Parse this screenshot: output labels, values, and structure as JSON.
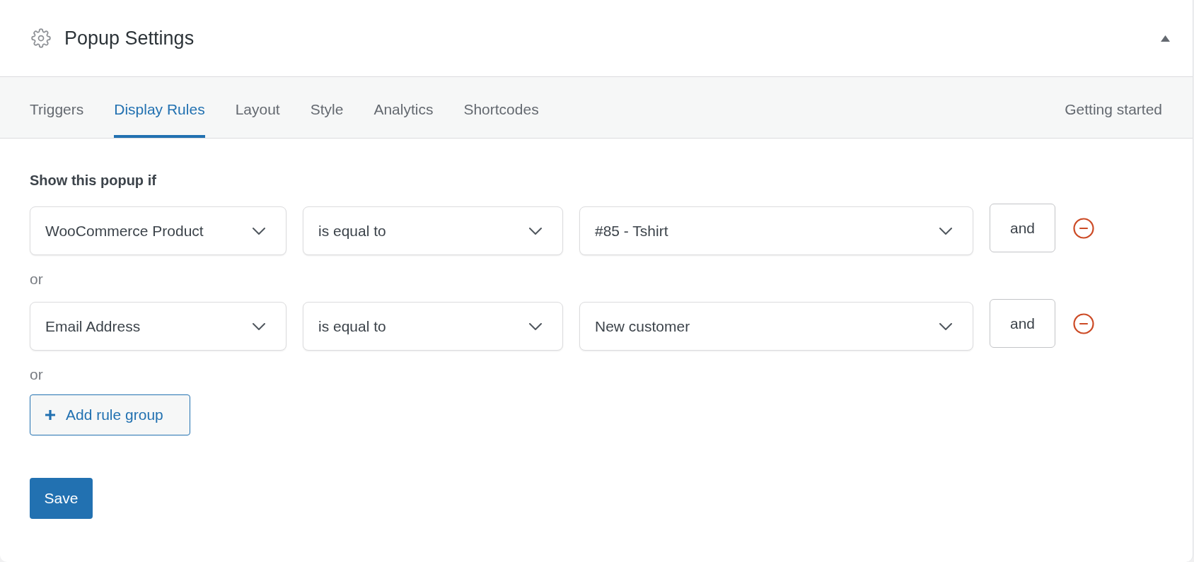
{
  "header": {
    "title": "Popup Settings",
    "expanded": true
  },
  "tabs": [
    {
      "label": "Triggers",
      "selected": false
    },
    {
      "label": "Display Rules",
      "selected": true
    },
    {
      "label": "Layout",
      "selected": false
    },
    {
      "label": "Style",
      "selected": false
    },
    {
      "label": "Analytics",
      "selected": false
    },
    {
      "label": "Shortcodes",
      "selected": false
    }
  ],
  "help_link": "Getting started",
  "rules_heading": "Show this popup if",
  "rule_groups": [
    {
      "rules": [
        {
          "field": "WooCommerce Product",
          "operator": "is equal to",
          "value": "#85 - Tshirt",
          "and_label": "and"
        }
      ],
      "or_label": "or"
    },
    {
      "rules": [
        {
          "field": "Email Address",
          "operator": "is equal to",
          "value": "New customer",
          "and_label": "and"
        }
      ],
      "or_label": "or"
    }
  ],
  "add_group_button": "Add rule group",
  "save_button": "Save"
}
